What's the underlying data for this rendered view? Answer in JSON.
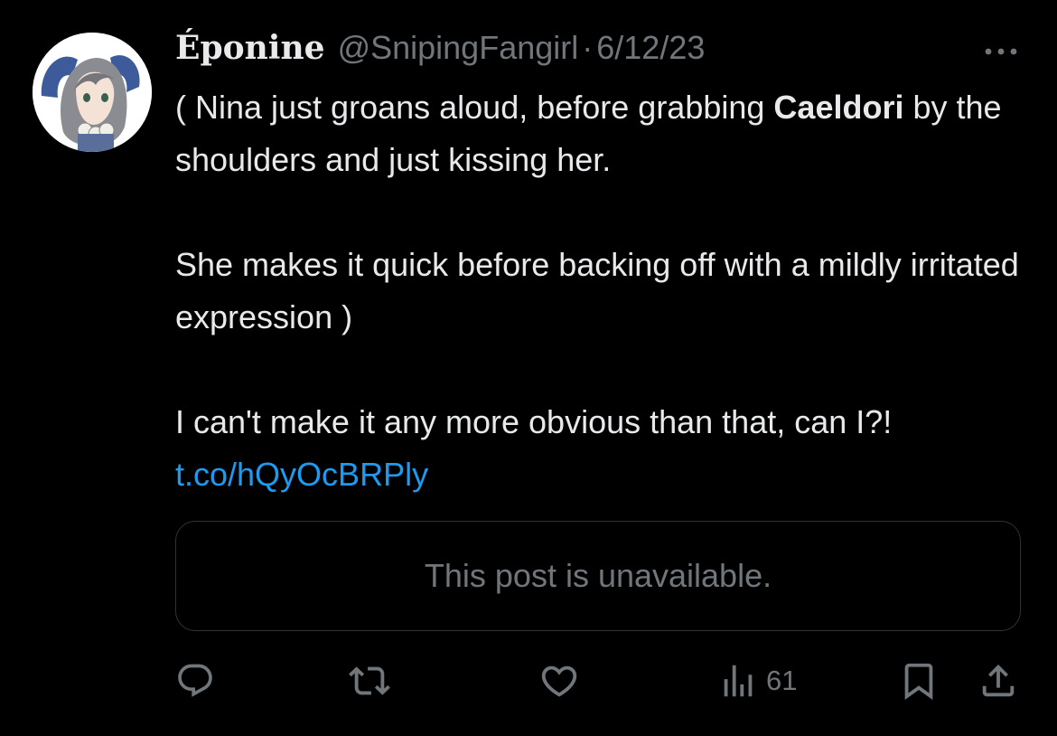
{
  "post": {
    "display_name": "Éponine",
    "handle": "@SnipingFangirl",
    "separator": "·",
    "date": "6/12/23",
    "more_icon": "more-horizontal-icon",
    "text": {
      "line1_prefix": "( Nina just groans aloud, before grabbing ",
      "mention": "Caeldori",
      "line1_suffix": " by the shoulders and just kissing her.",
      "para2": "She makes it quick before backing off with a mildly irritated expression )",
      "para3_prefix": "I can't make it any more obvious than that, can I?! ",
      "link": "t.co/hQyOcBRPly"
    },
    "quoted_post": {
      "message": "This post is unavailable."
    }
  },
  "actions": {
    "reply": {
      "icon": "reply-icon"
    },
    "repost": {
      "icon": "repost-icon"
    },
    "like": {
      "icon": "like-icon"
    },
    "views": {
      "icon": "views-icon",
      "count": "61"
    },
    "bookmark": {
      "icon": "bookmark-icon"
    },
    "share": {
      "icon": "share-icon"
    }
  },
  "colors": {
    "background": "#000000",
    "text_primary": "#e7e9ea",
    "text_secondary": "#71767b",
    "link": "#1d9bf0",
    "border": "#2f3336"
  }
}
